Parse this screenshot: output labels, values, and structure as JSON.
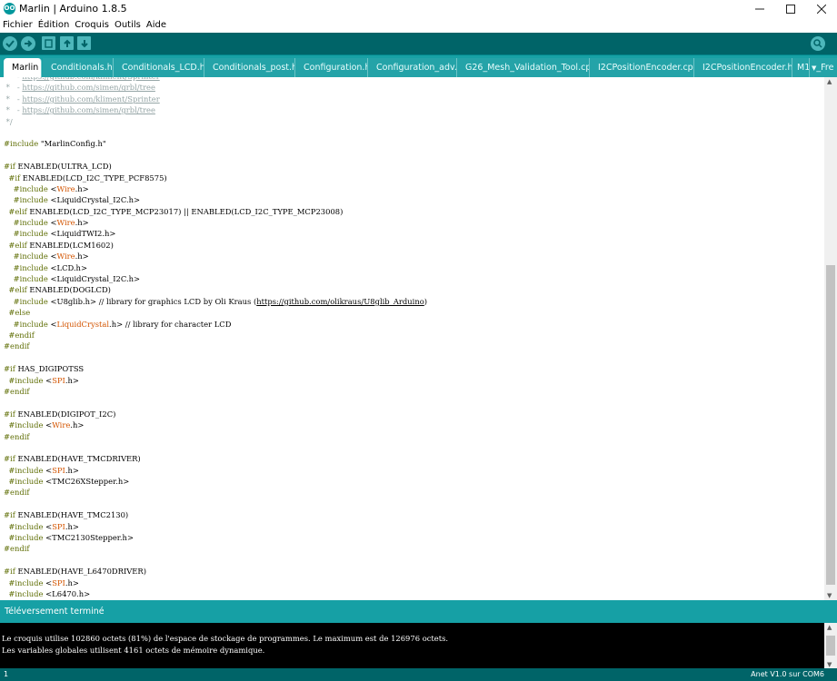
{
  "window": {
    "title": "Marlin | Arduino 1.8.5",
    "icon_label": "OO",
    "controls": [
      "minimize-icon",
      "maximize-icon",
      "close-icon"
    ]
  },
  "menu": [
    "Fichier",
    "Édition",
    "Croquis",
    "Outils",
    "Aide"
  ],
  "toolbar": {
    "buttons": [
      "verify-icon",
      "upload-icon",
      "new-icon",
      "open-icon",
      "save-icon"
    ],
    "right": "serial-monitor-icon"
  },
  "tabs": [
    "Marlin",
    "Conditionals.h",
    "Conditionals_LCD.h",
    "Conditionals_post.h",
    "Configuration.h",
    "Configuration_adv.h",
    "G26_Mesh_Validation_Tool.cpp",
    "I2CPositionEncoder.cpp",
    "I2CPositionEncoder.h",
    "M1",
    "_Fre"
  ],
  "editor": {
    "lines": [
      " *   - https://github.com/kliment/Sprinter",
      " *   - https://github.com/simen/grbl/tree",
      " *   - https://github.com/kliment/Sprinter",
      " *   - https://github.com/simen/grbl/tree",
      " */",
      "",
      "#include \"MarlinConfig.h\"",
      "",
      "#if ENABLED(ULTRA_LCD)",
      "  #if ENABLED(LCD_I2C_TYPE_PCF8575)",
      "    #include <Wire.h>",
      "    #include <LiquidCrystal_I2C.h>",
      "  #elif ENABLED(LCD_I2C_TYPE_MCP23017) || ENABLED(LCD_I2C_TYPE_MCP23008)",
      "    #include <Wire.h>",
      "    #include <LiquidTWI2.h>",
      "  #elif ENABLED(LCM1602)",
      "    #include <Wire.h>",
      "    #include <LCD.h>",
      "    #include <LiquidCrystal_I2C.h>",
      "  #elif ENABLED(DOGLCD)",
      "    #include <U8glib.h> // library for graphics LCD by Oli Kraus (https://github.com/olikraus/U8glib_Arduino)",
      "  #else",
      "    #include <LiquidCrystal.h> // library for character LCD",
      "  #endif",
      "#endif",
      "",
      "#if HAS_DIGIPOTSS",
      "  #include <SPI.h>",
      "#endif",
      "",
      "#if ENABLED(DIGIPOT_I2C)",
      "  #include <Wire.h>",
      "#endif",
      "",
      "#if ENABLED(HAVE_TMCDRIVER)",
      "  #include <SPI.h>",
      "  #include <TMC26XStepper.h>",
      "#endif",
      "",
      "#if ENABLED(HAVE_TMC2130)",
      "  #include <SPI.h>",
      "  #include <TMC2130Stepper.h>",
      "#endif",
      "",
      "#if ENABLED(HAVE_L6470DRIVER)",
      "  #include <SPI.h>",
      "  #include <L6470.h>",
      "#endif"
    ]
  },
  "status": "Téléversement terminé",
  "console": [
    "Le croquis utilise 102860 octets (81%) de l'espace de stockage de programmes. Le maximum est de 126976 octets.",
    "Les variables globales utilisent 4161 octets de mémoire dynamique."
  ],
  "footer": {
    "line_number": "1",
    "board": "Anet V1.0 sur COM6"
  },
  "colors": {
    "toolbar": "#006468",
    "tabstrip": "#17a1a5",
    "status": "#16a0a5",
    "preprocessor": "#5e6d03",
    "keyword": "#d35400",
    "comment": "#95a5a6"
  }
}
